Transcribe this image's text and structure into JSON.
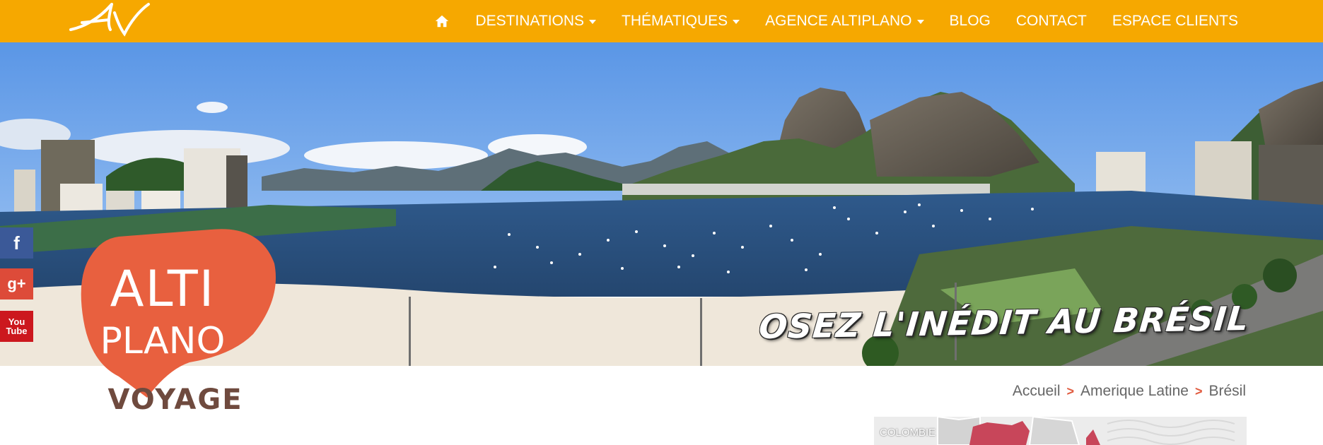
{
  "brand": {
    "mark_text": "AV"
  },
  "nav": {
    "home_label": "Accueil",
    "items": [
      {
        "label": "DESTINATIONS",
        "dropdown": true
      },
      {
        "label": "THÉMATIQUES",
        "dropdown": true
      },
      {
        "label": "AGENCE ALTIPLANO",
        "dropdown": true
      },
      {
        "label": "BLOG",
        "dropdown": false
      },
      {
        "label": "CONTACT",
        "dropdown": false
      },
      {
        "label": "ESPACE CLIENTS",
        "dropdown": false
      }
    ]
  },
  "hero": {
    "tagline": "OSEZ L'INÉDIT AU BRÉSIL"
  },
  "social": {
    "facebook": "f",
    "google_plus": "g+",
    "youtube_top": "You",
    "youtube_bottom": "Tube"
  },
  "logo": {
    "line1": "ALTI",
    "line2": "PLANO",
    "line3": "VOYAGE"
  },
  "breadcrumb": {
    "items": [
      "Accueil",
      "Amerique Latine",
      "Brésil"
    ],
    "separator": ">"
  },
  "map": {
    "label": "COLOMBIE"
  },
  "colors": {
    "nav_bg": "#f6a800",
    "logo_blob": "#e8603f",
    "logo_text_brown": "#6f4a3e",
    "breadcrumb_sep": "#e05a3e"
  }
}
